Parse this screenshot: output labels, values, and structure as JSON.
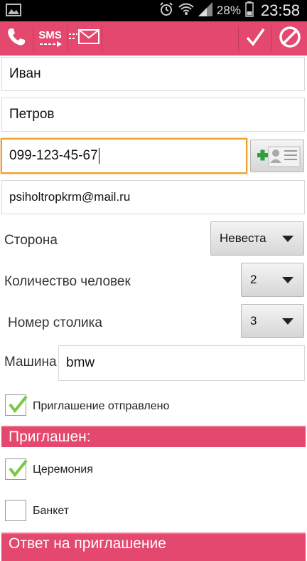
{
  "status_bar": {
    "battery_percent": "28%",
    "time": "23:58"
  },
  "action_bar": {
    "sms_label": "SMS",
    "icons": [
      "phone-icon",
      "sms-icon",
      "email-icon",
      "check-icon",
      "cancel-icon"
    ],
    "accent_color": "#e4486e"
  },
  "form": {
    "first_name": "Иван",
    "last_name": "Петров",
    "phone": "099-123-45-67",
    "email": "psiholtropkrm@mail.ru",
    "side": {
      "label": "Сторона",
      "value": "Невеста"
    },
    "guests": {
      "label": "Количество человек",
      "value": "2"
    },
    "table": {
      "label": "Номер столика",
      "value": "3"
    },
    "car": {
      "label": "Машина",
      "value": "bmw"
    },
    "invitation_sent": {
      "label": "Приглашение отправлено",
      "checked": true
    }
  },
  "invited_section": {
    "title": "Приглашен:",
    "ceremony": {
      "label": "Церемония",
      "checked": true
    },
    "banquet": {
      "label": "Банкет",
      "checked": false
    }
  },
  "response_section": {
    "title": "Ответ на приглашение"
  }
}
